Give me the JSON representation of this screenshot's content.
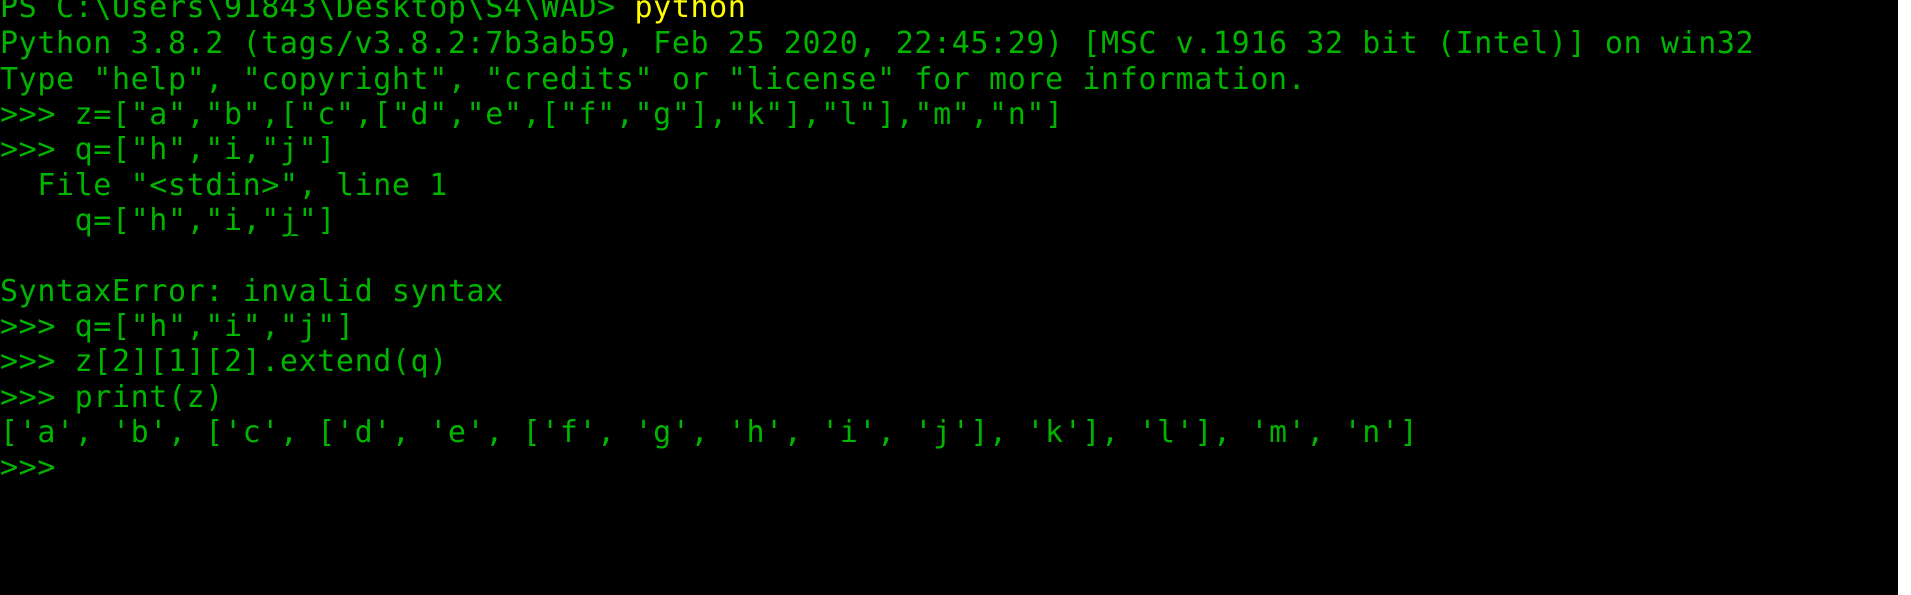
{
  "terminal": {
    "prompt_path": "PS C:\\Users\\91843\\Desktop\\S4\\WAD> ",
    "prompt_command": "python",
    "lines": [
      "Python 3.8.2 (tags/v3.8.2:7b3ab59, Feb 25 2020, 22:45:29) [MSC v.1916 32 bit (Intel)] on win32",
      "Type \"help\", \"copyright\", \"credits\" or \"license\" for more information.",
      ">>> z=[\"a\",\"b\",[\"c\",[\"d\",\"e\",[\"f\",\"g\"],\"k\"],\"l\"],\"m\",\"n\"]",
      ">>> q=[\"h\",\"i,\"j\"]",
      "  File \"<stdin>\", line 1",
      "    q=[\"h\",\"i,\"j\"]",
      "",
      "SyntaxError: invalid syntax",
      ">>> q=[\"h\",\"i\",\"j\"]",
      ">>> z[2][1][2].extend(q)",
      ">>> print(z)",
      "['a', 'b', ['c', ['d', 'e', ['f', 'g', 'h', 'i', 'j'], 'k'], 'l'], 'm', 'n']",
      ">>> "
    ]
  },
  "colors": {
    "background": "#000000",
    "output_text": "#00b400",
    "command_text": "#ffff00",
    "scrollbar": "#ffffff"
  }
}
